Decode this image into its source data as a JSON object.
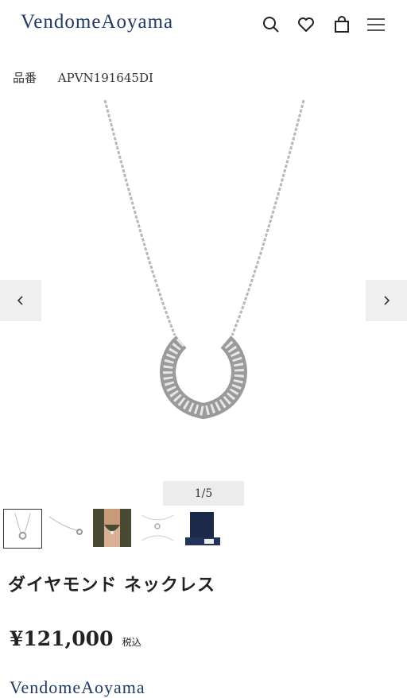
{
  "header": {
    "logo_text": "VendomeAoyama",
    "icons": [
      "search-icon",
      "heart-icon",
      "shopping-bag-icon",
      "menu-icon"
    ]
  },
  "product": {
    "code_label": "品番",
    "code_value": "APVN191645DI",
    "title": "ダイヤモンド ネックレス",
    "price": "¥121,000",
    "tax_note": "税込"
  },
  "gallery": {
    "counter": "1/5",
    "prev_icon": "chevron-left-icon",
    "next_icon": "chevron-right-icon",
    "thumbnail_count": 5,
    "active_index": 1
  },
  "footer": {
    "logo_text": "VendomeAoyama"
  },
  "colors": {
    "brand": "#1f3a64",
    "arrow_bg": "#efefef",
    "counter_bg": "#ececec"
  }
}
